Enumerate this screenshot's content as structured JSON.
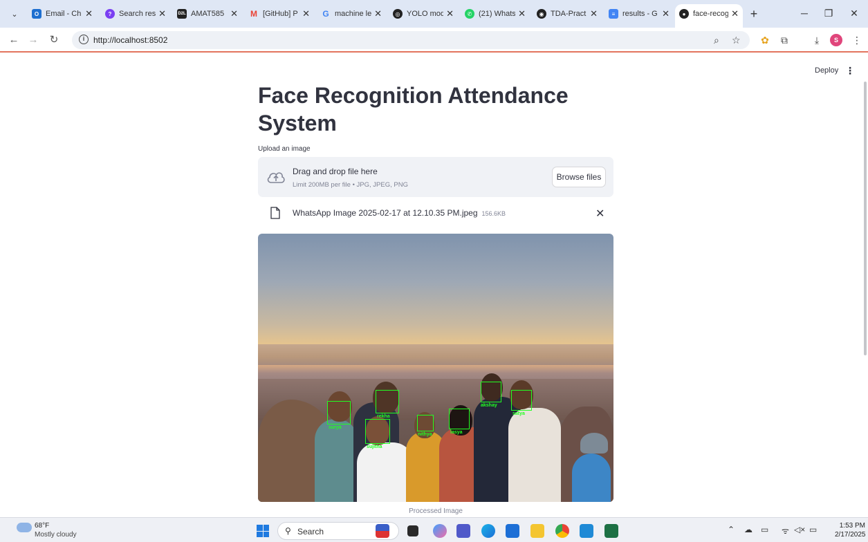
{
  "browser": {
    "tabs": [
      {
        "title": "Email - Ch",
        "favicon_color": "#1e6fd0",
        "favicon_glyph": "O"
      },
      {
        "title": "Search res",
        "favicon_color": "#7a3ff2",
        "favicon_glyph": "?"
      },
      {
        "title": "AMAT585",
        "favicon_color": "#222222",
        "favicon_glyph": "D2L"
      },
      {
        "title": "[GitHub] P",
        "favicon_color": "#ea4335",
        "favicon_glyph": "M"
      },
      {
        "title": "machine le",
        "favicon_color": "#4285f4",
        "favicon_glyph": "G"
      },
      {
        "title": "YOLO mod",
        "favicon_color": "#222222",
        "favicon_glyph": "◎"
      },
      {
        "title": "(21) Whats",
        "favicon_color": "#25d366",
        "favicon_glyph": "✆"
      },
      {
        "title": "TDA-Pract",
        "favicon_color": "#222222",
        "favicon_glyph": "◉"
      },
      {
        "title": "results - G",
        "favicon_color": "#4285f4",
        "favicon_glyph": "≡"
      },
      {
        "title": "face-recog",
        "favicon_color": "#222222",
        "favicon_glyph": "●"
      }
    ],
    "new_tab": "+",
    "url": "http://localhost:8502",
    "profile_initial": "S"
  },
  "app": {
    "deploy_label": "Deploy",
    "menu_glyph": "⋮",
    "title": "Face Recognition Attendance System",
    "uploader": {
      "label": "Upload an image",
      "drop_text": "Drag and drop file here",
      "limit_text": "Limit 200MB per file • JPG, JPEG, PNG",
      "browse_label": "Browse files"
    },
    "file": {
      "name": "WhatsApp Image 2025-02-17 at 12.10.35 PM.jpeg",
      "size": "156.6KB",
      "remove_glyph": "✕"
    },
    "image": {
      "caption": "Processed Image",
      "faces": [
        "surya",
        "rekha",
        "sujitha",
        "nithya",
        "lasya",
        "akshay",
        "satya"
      ]
    }
  },
  "taskbar": {
    "temperature": "68°F",
    "condition": "Mostly cloudy",
    "search_placeholder": "Search",
    "time": "1:53 PM",
    "date": "2/17/2025"
  }
}
